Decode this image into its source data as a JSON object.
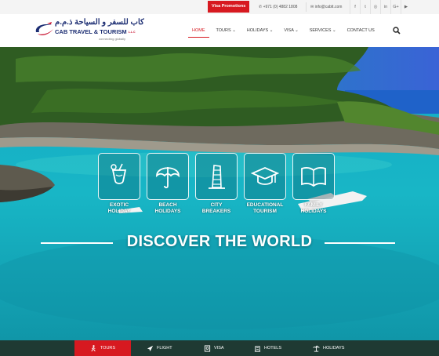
{
  "topbar": {
    "promo": "Visa Promotions",
    "phone": "+971 (0) 4882 1808",
    "email": "info@cabtt.com",
    "social_icons": [
      "facebook-icon",
      "twitter-icon",
      "instagram-icon",
      "linkedin-icon",
      "google-plus-icon",
      "youtube-icon"
    ],
    "social_glyphs": [
      "f",
      "t",
      "◎",
      "in",
      "G+",
      "▶"
    ]
  },
  "logo": {
    "arabic": "كاب للسفر و السياحة ذ.م.م",
    "english": "CAB TRAVEL & TOURISM",
    "suffix": "L.L.C",
    "tagline": "connecting globally"
  },
  "nav": {
    "items": [
      "HOME",
      "TOURS",
      "HOLIDAYS",
      "VISA",
      "SERVICES",
      "CONTACT US"
    ],
    "caret": "⌄"
  },
  "hero": {
    "categories": [
      {
        "line1": "EXOTIC",
        "line2": "HOLIDAY",
        "icon": "cocktail-icon"
      },
      {
        "line1": "BEACH",
        "line2": "HOLIDAYS",
        "icon": "umbrella-icon"
      },
      {
        "line1": "CITY",
        "line2": "BREAKERS",
        "icon": "tower-icon"
      },
      {
        "line1": "EDUCATIONAL",
        "line2": "TOURISM",
        "icon": "graduation-cap-icon"
      },
      {
        "line1": "FAMILY",
        "line2": "HOLIDAYS",
        "icon": "book-icon"
      }
    ],
    "headline": "DISCOVER THE WORLD"
  },
  "tabs": [
    {
      "label": "TOURS",
      "icon": "walker-icon"
    },
    {
      "label": "FLIGHT",
      "icon": "plane-icon"
    },
    {
      "label": "VISA",
      "icon": "passport-icon"
    },
    {
      "label": "HOTELS",
      "icon": "hotel-icon"
    },
    {
      "label": "HOLIDAYS",
      "icon": "palm-icon"
    }
  ],
  "colors": {
    "accent": "#d71920",
    "brand_blue": "#1d2e73",
    "tab_bar": "#1f3a33"
  }
}
